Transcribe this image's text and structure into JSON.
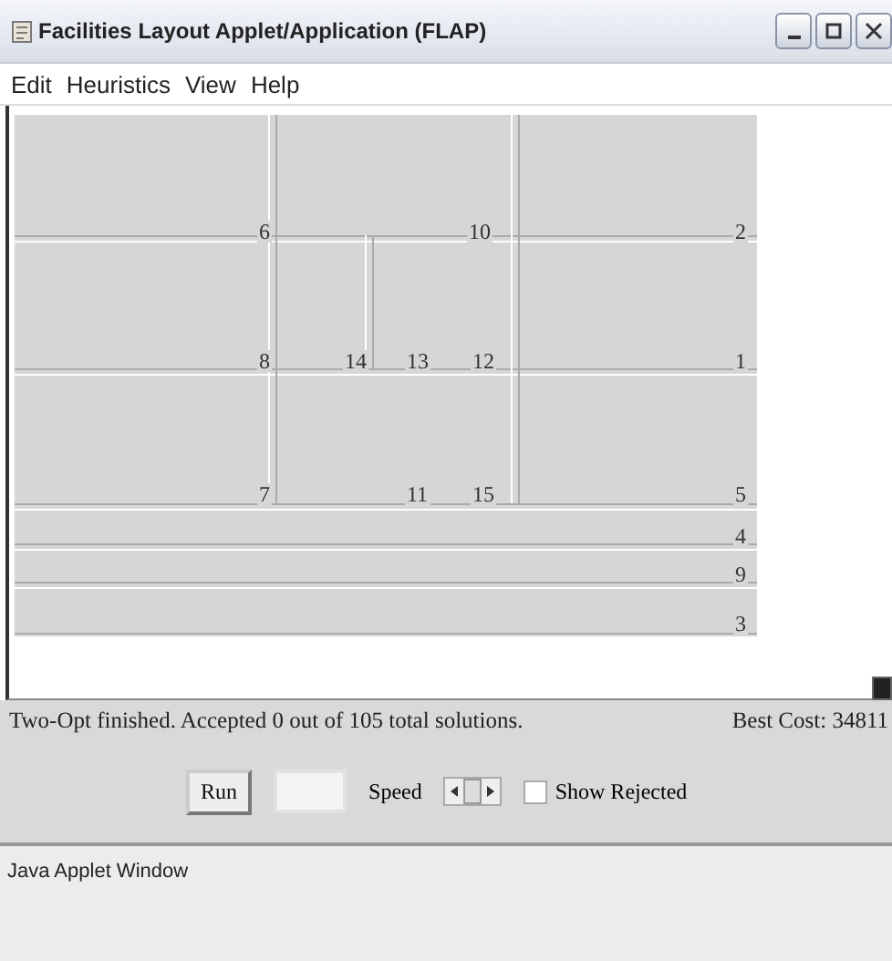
{
  "window": {
    "title": "Facilities Layout Applet/Application (FLAP)"
  },
  "menu": [
    "Edit",
    "Heuristics",
    "View",
    "Help"
  ],
  "layout": {
    "departments": [
      {
        "label": "6"
      },
      {
        "label": "10"
      },
      {
        "label": "2"
      },
      {
        "label": "8"
      },
      {
        "label": "14"
      },
      {
        "label": "13"
      },
      {
        "label": "12"
      },
      {
        "label": "1"
      },
      {
        "label": "7"
      },
      {
        "label": "11"
      },
      {
        "label": "15"
      },
      {
        "label": "5"
      },
      {
        "label": "4"
      },
      {
        "label": "9"
      },
      {
        "label": "3"
      }
    ]
  },
  "status": {
    "message": "Two-Opt finished. Accepted 0 out of 105 total solutions.",
    "best_cost": "Best Cost: 34811"
  },
  "controls": {
    "run_button": {
      "label": "Run",
      "disabled": false
    },
    "second_button": {
      "disabled": true
    },
    "speed_label": "Speed",
    "show_rejected": {
      "label": "Show Rejected",
      "checked": false
    }
  },
  "footer": "Java Applet Window"
}
